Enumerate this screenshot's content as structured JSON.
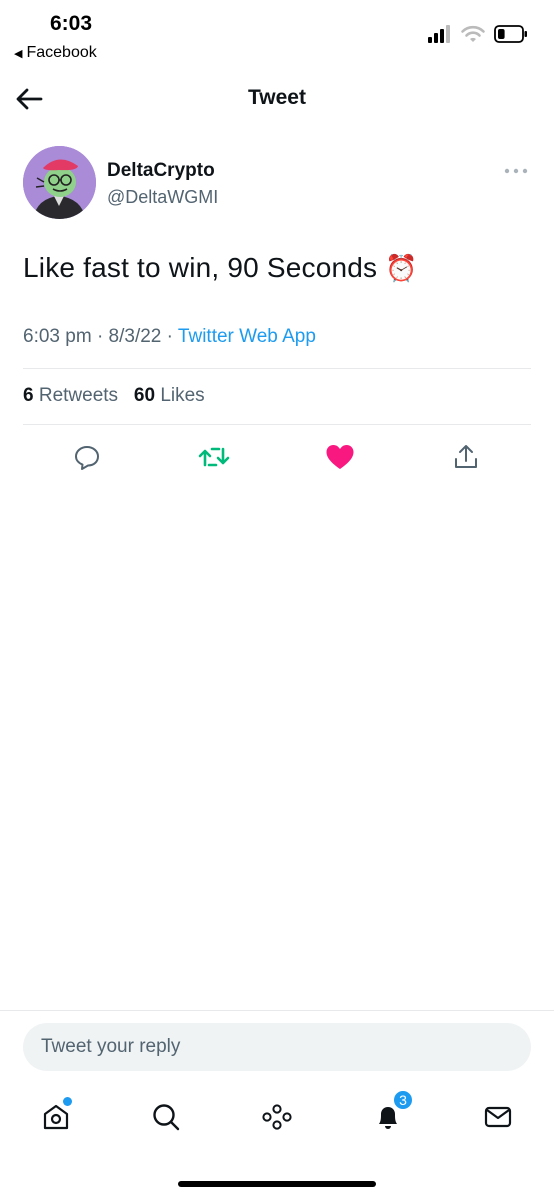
{
  "status_bar": {
    "time": "6:03",
    "back_app": "Facebook",
    "battery_level": 0.3
  },
  "header": {
    "title": "Tweet"
  },
  "tweet": {
    "author": {
      "display_name": "DeltaCrypto",
      "handle": "@DeltaWGMI",
      "avatar_color": "#a98bd8"
    },
    "text": "Like fast to win, 90 Seconds",
    "emoji": "⏰",
    "time": "6:03 pm",
    "separator": "·",
    "date": "8/3/22",
    "source": "Twitter Web App",
    "stats": {
      "retweets_count": "6",
      "retweets_label": "Retweets",
      "likes_count": "60",
      "likes_label": "Likes"
    },
    "actions": [
      {
        "icon": "reply-icon"
      },
      {
        "icon": "retweet-icon",
        "color": "#00ba7c",
        "active": true
      },
      {
        "icon": "heart-icon",
        "color": "#f91880",
        "active": true
      },
      {
        "icon": "share-icon"
      }
    ]
  },
  "reply": {
    "placeholder": "Tweet your reply"
  },
  "tab_bar": {
    "tabs": [
      {
        "icon": "home-icon",
        "has_dot": true
      },
      {
        "icon": "search-icon"
      },
      {
        "icon": "spaces-icon"
      },
      {
        "icon": "notifications-icon",
        "badge": "3"
      },
      {
        "icon": "messages-icon"
      }
    ]
  },
  "colors": {
    "accent": "#1d9bf0",
    "retweet": "#00ba7c",
    "like": "#f91880",
    "secondary_text": "#536471"
  }
}
